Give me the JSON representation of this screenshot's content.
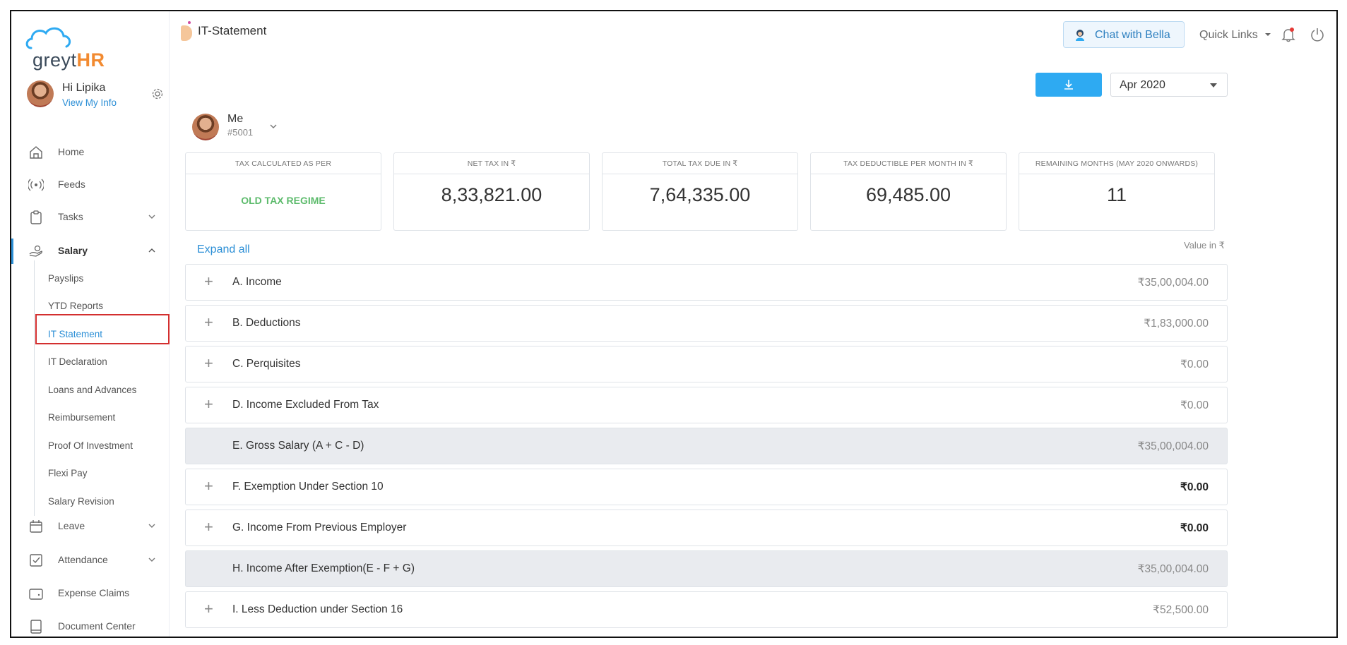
{
  "app": {
    "logo_prefix": "greyt",
    "logo_suffix": "HR",
    "greeting": "Hi Lipika",
    "profile_link": "View My Info"
  },
  "sidebar": {
    "items": [
      {
        "label": "Home",
        "icon": "home-icon"
      },
      {
        "label": "Feeds",
        "icon": "feeds-icon"
      },
      {
        "label": "Tasks",
        "icon": "tasks-icon"
      },
      {
        "label": "Salary",
        "icon": "salary-icon"
      },
      {
        "label": "Leave",
        "icon": "calendar-icon"
      },
      {
        "label": "Attendance",
        "icon": "attendance-icon"
      },
      {
        "label": "Expense Claims",
        "icon": "wallet-icon"
      },
      {
        "label": "Document Center",
        "icon": "document-icon"
      }
    ],
    "salary_sub": [
      "Payslips",
      "YTD Reports",
      "IT Statement",
      "IT Declaration",
      "Loans and Advances",
      "Reimbursement",
      "Proof Of Investment",
      "Flexi Pay",
      "Salary Revision"
    ]
  },
  "header": {
    "title": "IT-Statement",
    "chat_label": "Chat with Bella",
    "quick_links": "Quick Links"
  },
  "controls": {
    "month": "Apr 2020"
  },
  "employee": {
    "name": "Me",
    "id": "#5001"
  },
  "cards": [
    {
      "label": "TAX CALCULATED AS PER",
      "value": "OLD TAX REGIME"
    },
    {
      "label": "NET TAX IN ₹",
      "value": "8,33,821.00"
    },
    {
      "label": "TOTAL TAX DUE IN ₹",
      "value": "7,64,335.00"
    },
    {
      "label": "TAX DEDUCTIBLE PER MONTH IN ₹",
      "value": "69,485.00"
    },
    {
      "label": "REMAINING MONTHS (MAY 2020 ONWARDS)",
      "value": "11"
    }
  ],
  "expand_all": "Expand all",
  "value_in": "Value in ₹",
  "rows": [
    {
      "label": "A. Income",
      "value": "₹35,00,004.00"
    },
    {
      "label": "B. Deductions",
      "value": "₹1,83,000.00"
    },
    {
      "label": "C. Perquisites",
      "value": "₹0.00"
    },
    {
      "label": "D. Income Excluded From Tax",
      "value": "₹0.00"
    },
    {
      "label": "E. Gross Salary (A + C - D)",
      "value": "₹35,00,004.00"
    },
    {
      "label": "F. Exemption Under Section 10",
      "value": "₹0.00"
    },
    {
      "label": "G. Income From Previous Employer",
      "value": "₹0.00"
    },
    {
      "label": "H. Income After Exemption(E - F + G)",
      "value": "₹35,00,004.00"
    },
    {
      "label": "I. Less Deduction under Section 16",
      "value": "₹52,500.00"
    }
  ],
  "colors": {
    "accent": "#2c8fd6",
    "download_button": "#2eaaf2",
    "regime_green": "#5dbb6c",
    "logo_orange": "#f28a30",
    "selection_outline": "#d32f2f"
  }
}
